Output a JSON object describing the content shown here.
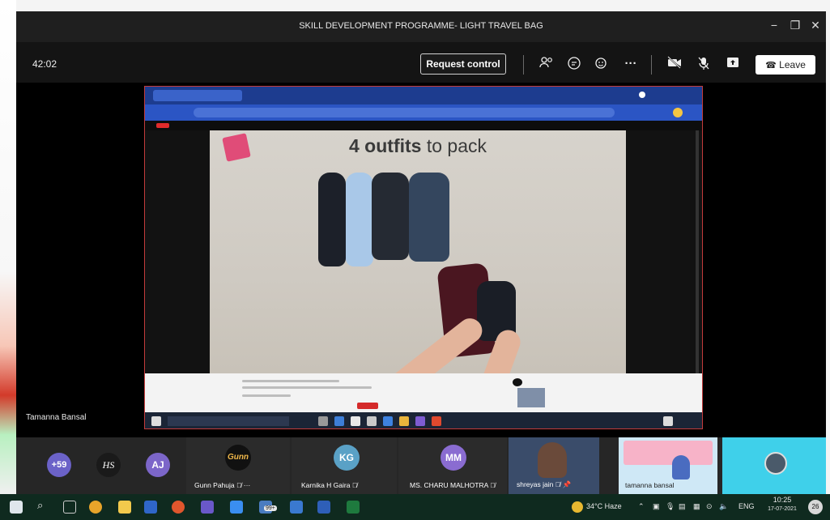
{
  "window": {
    "title": "SKILL DEVELOPMENT PROGRAMME- LIGHT TRAVEL BAG",
    "minimize": "−",
    "maximize": "❐",
    "close": "✕"
  },
  "toolbar": {
    "timer": "42:02",
    "request_control": "Request control",
    "more": "···",
    "leave": "Leave",
    "leave_icon": "☎"
  },
  "share": {
    "presenter": "Tamanna Bansal",
    "video_caption_bold": "4 outfits",
    "video_caption_rest": " to pack"
  },
  "gallery": {
    "overflow_count": "+59",
    "participants": [
      {
        "initials": "HS",
        "name": "",
        "color": "#2a2a2a"
      },
      {
        "initials": "AJ",
        "name": "",
        "color": "#7c66c9"
      },
      {
        "initials": "Gunn",
        "name": "Gunn Pahuja",
        "color": "#1a1a1a"
      },
      {
        "initials": "KG",
        "name": "Karnika H Gaira",
        "color": "#5aa1c6"
      },
      {
        "initials": "MM",
        "name": "MS. CHARU MALHOTRA",
        "color": "#8a6cd1"
      },
      {
        "initials": "",
        "name": "shreyas jain",
        "color": "#3a4c6a"
      },
      {
        "initials": "",
        "name": "tamanna bansal",
        "color": "#cfe8f6"
      },
      {
        "initials": "",
        "name": "",
        "color": "#3fd0ea"
      }
    ]
  },
  "taskbar": {
    "weather": "34°C  Haze",
    "lang": "ENG",
    "time": "10:25",
    "date": "17-07-2021",
    "badge": "99+",
    "notif": "26"
  }
}
